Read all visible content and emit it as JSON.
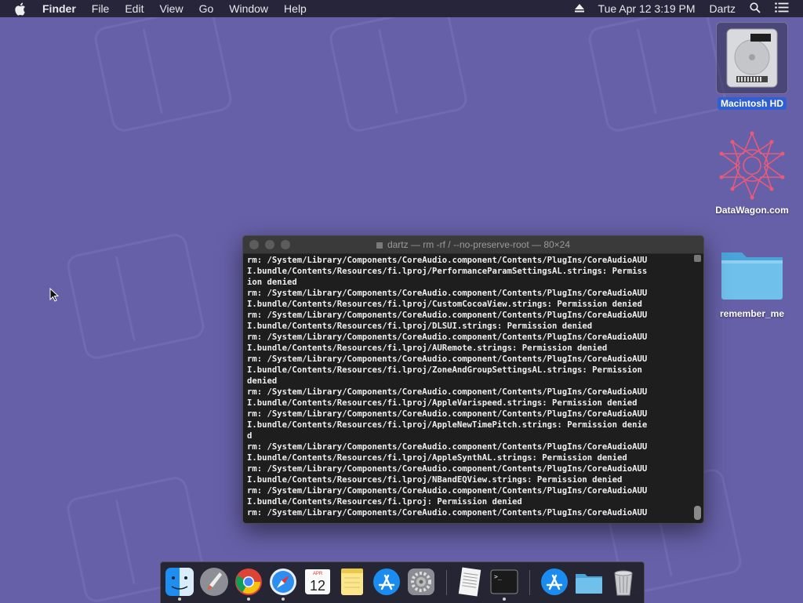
{
  "menubar": {
    "app": "Finder",
    "items": [
      "File",
      "Edit",
      "View",
      "Go",
      "Window",
      "Help"
    ],
    "datetime": "Tue Apr 12  3:19 PM",
    "user": "Dartz"
  },
  "desktop": {
    "icons": [
      {
        "label": "Macintosh HD",
        "icon": "hard-drive-icon",
        "selected": true
      },
      {
        "label": "DataWagon.com",
        "icon": "datawagon-logo-icon",
        "selected": false
      },
      {
        "label": "remember_me",
        "icon": "folder-icon",
        "selected": false
      }
    ]
  },
  "terminal": {
    "title": "dartz — rm -rf / --no-preserve-root — 80×24",
    "lines": [
      "rm: /System/Library/Components/CoreAudio.component/Contents/PlugIns/CoreAudioAUU",
      "I.bundle/Contents/Resources/fi.lproj/PerformanceParamSettingsAL.strings: Permiss",
      "ion denied",
      "rm: /System/Library/Components/CoreAudio.component/Contents/PlugIns/CoreAudioAUU",
      "I.bundle/Contents/Resources/fi.lproj/CustomCocoaView.strings: Permission denied",
      "rm: /System/Library/Components/CoreAudio.component/Contents/PlugIns/CoreAudioAUU",
      "I.bundle/Contents/Resources/fi.lproj/DLSUI.strings: Permission denied",
      "rm: /System/Library/Components/CoreAudio.component/Contents/PlugIns/CoreAudioAUU",
      "I.bundle/Contents/Resources/fi.lproj/AURemote.strings: Permission denied",
      "rm: /System/Library/Components/CoreAudio.component/Contents/PlugIns/CoreAudioAUU",
      "I.bundle/Contents/Resources/fi.lproj/ZoneAndGroupSettingsAL.strings: Permission",
      "denied",
      "rm: /System/Library/Components/CoreAudio.component/Contents/PlugIns/CoreAudioAUU",
      "I.bundle/Contents/Resources/fi.lproj/AppleVarispeed.strings: Permission denied",
      "rm: /System/Library/Components/CoreAudio.component/Contents/PlugIns/CoreAudioAUU",
      "I.bundle/Contents/Resources/fi.lproj/AppleNewTimePitch.strings: Permission denie",
      "d",
      "rm: /System/Library/Components/CoreAudio.component/Contents/PlugIns/CoreAudioAUU",
      "I.bundle/Contents/Resources/fi.lproj/AppleSynthAL.strings: Permission denied",
      "rm: /System/Library/Components/CoreAudio.component/Contents/PlugIns/CoreAudioAUU",
      "I.bundle/Contents/Resources/fi.lproj/NBandEQView.strings: Permission denied",
      "rm: /System/Library/Components/CoreAudio.component/Contents/PlugIns/CoreAudioAUU",
      "I.bundle/Contents/Resources/fi.lproj: Permission denied",
      "rm: /System/Library/Components/CoreAudio.component/Contents/PlugIns/CoreAudioAUU"
    ]
  },
  "dock": {
    "calendar": {
      "month": "APR",
      "day": "12"
    },
    "terminal_prompt": ">_",
    "items": [
      "finder-icon",
      "launchpad-icon",
      "chrome-icon",
      "safari-icon",
      "calendar-icon",
      "notes-icon",
      "app-store-icon",
      "system-preferences-icon",
      "textedit-icon",
      "terminal-icon",
      "app-store-download-icon",
      "downloads-folder-icon",
      "trash-icon"
    ]
  },
  "colors": {
    "desktop": "#6660a8",
    "menubar": "#26253a",
    "selection": "#2f5fd0",
    "terminal_bg": "#1e1e1e"
  }
}
